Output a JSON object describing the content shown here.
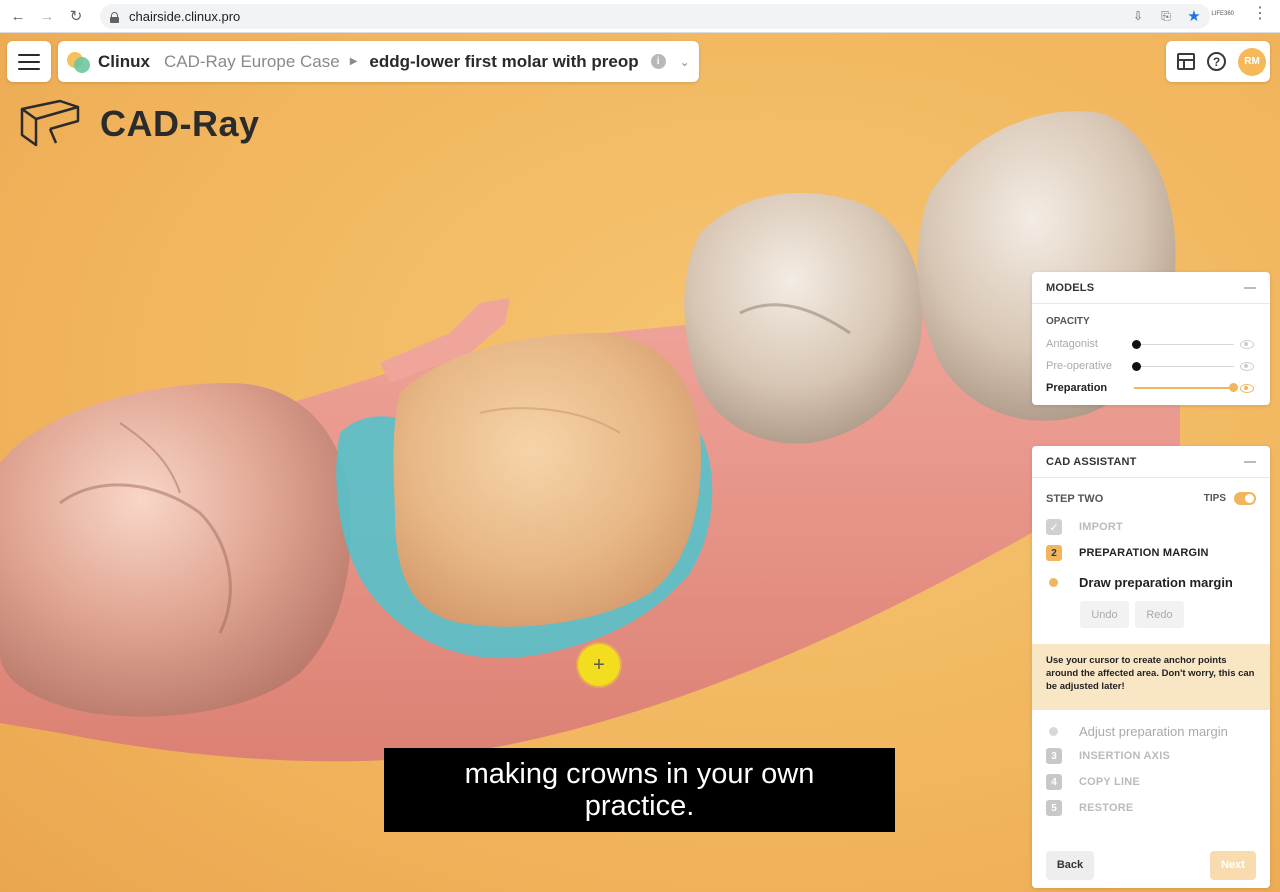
{
  "browser": {
    "url": "chairside.clinux.pro",
    "back_icon": "back-arrow-icon",
    "forward_icon": "forward-arrow-icon",
    "reload_icon": "reload-icon",
    "ext_label": "LIFE360"
  },
  "header": {
    "brand": "Clinux",
    "case_name": "CAD-Ray Europe Case",
    "current_case": "eddg-lower first molar with preop",
    "avatar_initials": "RM"
  },
  "logo_text": "CAD-Ray",
  "subtitle": "making crowns in your own practice.",
  "models_panel": {
    "title": "MODELS",
    "opacity_label": "OPACITY",
    "sliders": [
      {
        "label": "Antagonist",
        "level": 0,
        "active": false
      },
      {
        "label": "Pre-operative",
        "level": 0,
        "active": false
      },
      {
        "label": "Preparation",
        "level": 1,
        "active": true
      }
    ]
  },
  "cad_assistant": {
    "title": "CAD ASSISTANT",
    "step_title": "STEP TWO",
    "tips_label": "TIPS",
    "tips_on": true,
    "steps_done": [
      {
        "label": "IMPORT"
      }
    ],
    "current_step": {
      "num": "2",
      "label": "PREPARATION MARGIN"
    },
    "current_substep": "Draw preparation margin",
    "undo_label": "Undo",
    "redo_label": "Redo",
    "tip_text": "Use your cursor to create anchor points around the affected area. Don't worry, this can be adjusted later!",
    "next_substep": "Adjust preparation margin",
    "upcoming_steps": [
      {
        "num": "3",
        "label": "INSERTION AXIS"
      },
      {
        "num": "4",
        "label": "COPY LINE"
      },
      {
        "num": "5",
        "label": "RESTORE"
      }
    ],
    "back_label": "Back",
    "next_label": "Next"
  },
  "colors": {
    "accent": "#f1b55d",
    "background": "#f1b55d",
    "gum": "#e7958a",
    "margin_line": "#4fc4cf"
  }
}
